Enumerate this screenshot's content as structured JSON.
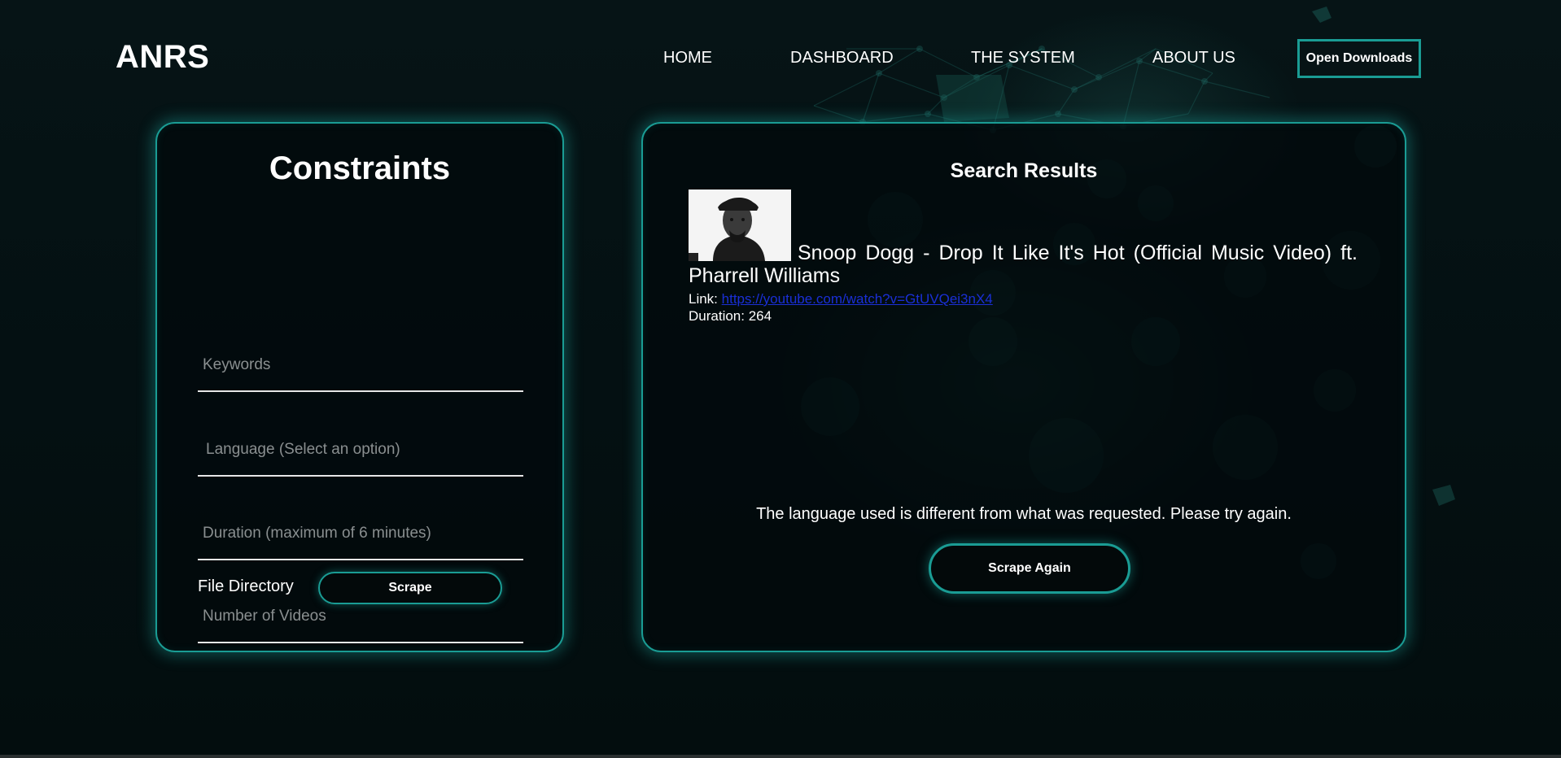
{
  "brand": {
    "logo": "ANRS"
  },
  "nav": {
    "items": [
      "HOME",
      "DASHBOARD",
      "THE SYSTEM",
      "ABOUT US"
    ],
    "downloads_label": "Open Downloads"
  },
  "constraints": {
    "title": "Constraints",
    "keywords_placeholder": "Keywords",
    "language_placeholder": "Language (Select an option)",
    "duration_placeholder": "Duration (maximum of 6 minutes)",
    "videos_placeholder": "Number of Videos",
    "file_directory_label": "File Directory",
    "scrape_label": "Scrape"
  },
  "results": {
    "title": "Search Results",
    "video": {
      "title": "Snoop Dogg - Drop It Like It's Hot (Official Music Video) ft. Pharrell Williams",
      "link_label": "Link:",
      "url": "https://youtube.com/watch?v=GtUVQei3nX4",
      "duration_label": "Duration:",
      "duration": "264"
    },
    "message": "The language used is different from what was requested. Please try again.",
    "scrape_again_label": "Scrape Again"
  },
  "colors": {
    "accent": "#1a9c94",
    "background": "#041012",
    "link": "#1a2fd6",
    "placeholder": "#8a8f90"
  }
}
